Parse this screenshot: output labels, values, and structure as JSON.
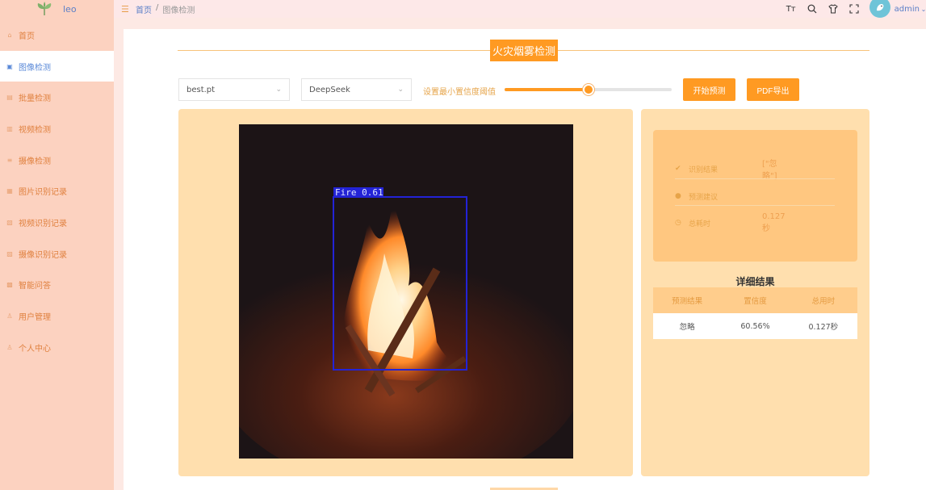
{
  "app": {
    "name": "leo",
    "colors": {
      "accent": "#ff9a22",
      "sidebar": "#fcd2c0",
      "panel": "#ffdfae"
    }
  },
  "sidebar": {
    "items": [
      {
        "label": "首页",
        "icon": "home-icon",
        "active": false
      },
      {
        "label": "图像检测",
        "icon": "image-icon",
        "active": true
      },
      {
        "label": "批量检测",
        "icon": "batch-icon",
        "active": false
      },
      {
        "label": "视频检测",
        "icon": "video-icon",
        "active": false
      },
      {
        "label": "摄像检测",
        "icon": "camera-icon",
        "active": false
      },
      {
        "label": "图片识别记录",
        "icon": "image-record-icon",
        "active": false
      },
      {
        "label": "视频识别记录",
        "icon": "video-record-icon",
        "active": false
      },
      {
        "label": "摄像识别记录",
        "icon": "camera-record-icon",
        "active": false
      },
      {
        "label": "智能问答",
        "icon": "chat-icon",
        "active": false
      },
      {
        "label": "用户管理",
        "icon": "user-icon",
        "active": false
      },
      {
        "label": "个人中心",
        "icon": "profile-icon",
        "active": false
      }
    ]
  },
  "header": {
    "breadcrumb": {
      "home": "首页",
      "separator": "/",
      "current": "图像检测"
    },
    "user": "admin"
  },
  "main": {
    "title": "火灾烟雾检测",
    "model_select": {
      "value": "best.pt"
    },
    "llm_select": {
      "value": "DeepSeek"
    },
    "slider": {
      "label": "设置最小置信度阈值",
      "value": 0.5
    },
    "predict_button": "开始预测",
    "pdf_button": "PDF导出",
    "detection": {
      "label": "Fire  0.61"
    },
    "result": {
      "result_label": "识别结果",
      "result_value": "[\"忽略\"]",
      "suggest_label": "预测建议",
      "time_label": "总耗时",
      "time_value": "0.127秒"
    },
    "detail": {
      "title": "详细结果",
      "headers": [
        "预测结果",
        "置信度",
        "总用时"
      ],
      "row": [
        "忽略",
        "60.56%",
        "0.127秒"
      ]
    }
  }
}
